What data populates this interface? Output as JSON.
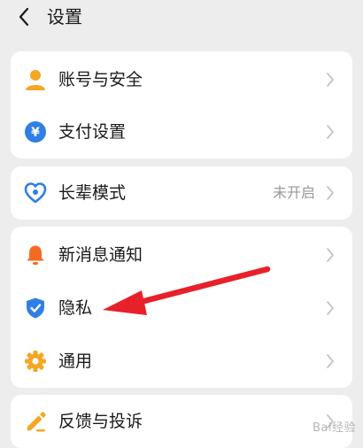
{
  "header": {
    "title": "设置"
  },
  "sections": [
    {
      "items": [
        {
          "label": "账号与安全",
          "icon": "person-icon",
          "color": "#F5A623"
        },
        {
          "label": "支付设置",
          "icon": "yuan-icon",
          "color": "#2F7FE5"
        }
      ]
    },
    {
      "items": [
        {
          "label": "长辈模式",
          "icon": "heart-icon",
          "color": "#2F7FE5",
          "value": "未开启"
        }
      ]
    },
    {
      "items": [
        {
          "label": "新消息通知",
          "icon": "bell-icon",
          "color": "#F36B21"
        },
        {
          "label": "隐私",
          "icon": "shield-icon",
          "color": "#2F7FE5"
        },
        {
          "label": "通用",
          "icon": "gear-icon",
          "color": "#F5A623"
        }
      ]
    },
    {
      "items": [
        {
          "label": "反馈与投诉",
          "icon": "pencil-icon",
          "color": "#F5A623"
        }
      ]
    }
  ],
  "annotation": {
    "color": "#E8202A"
  },
  "watermark": "Bai经验"
}
